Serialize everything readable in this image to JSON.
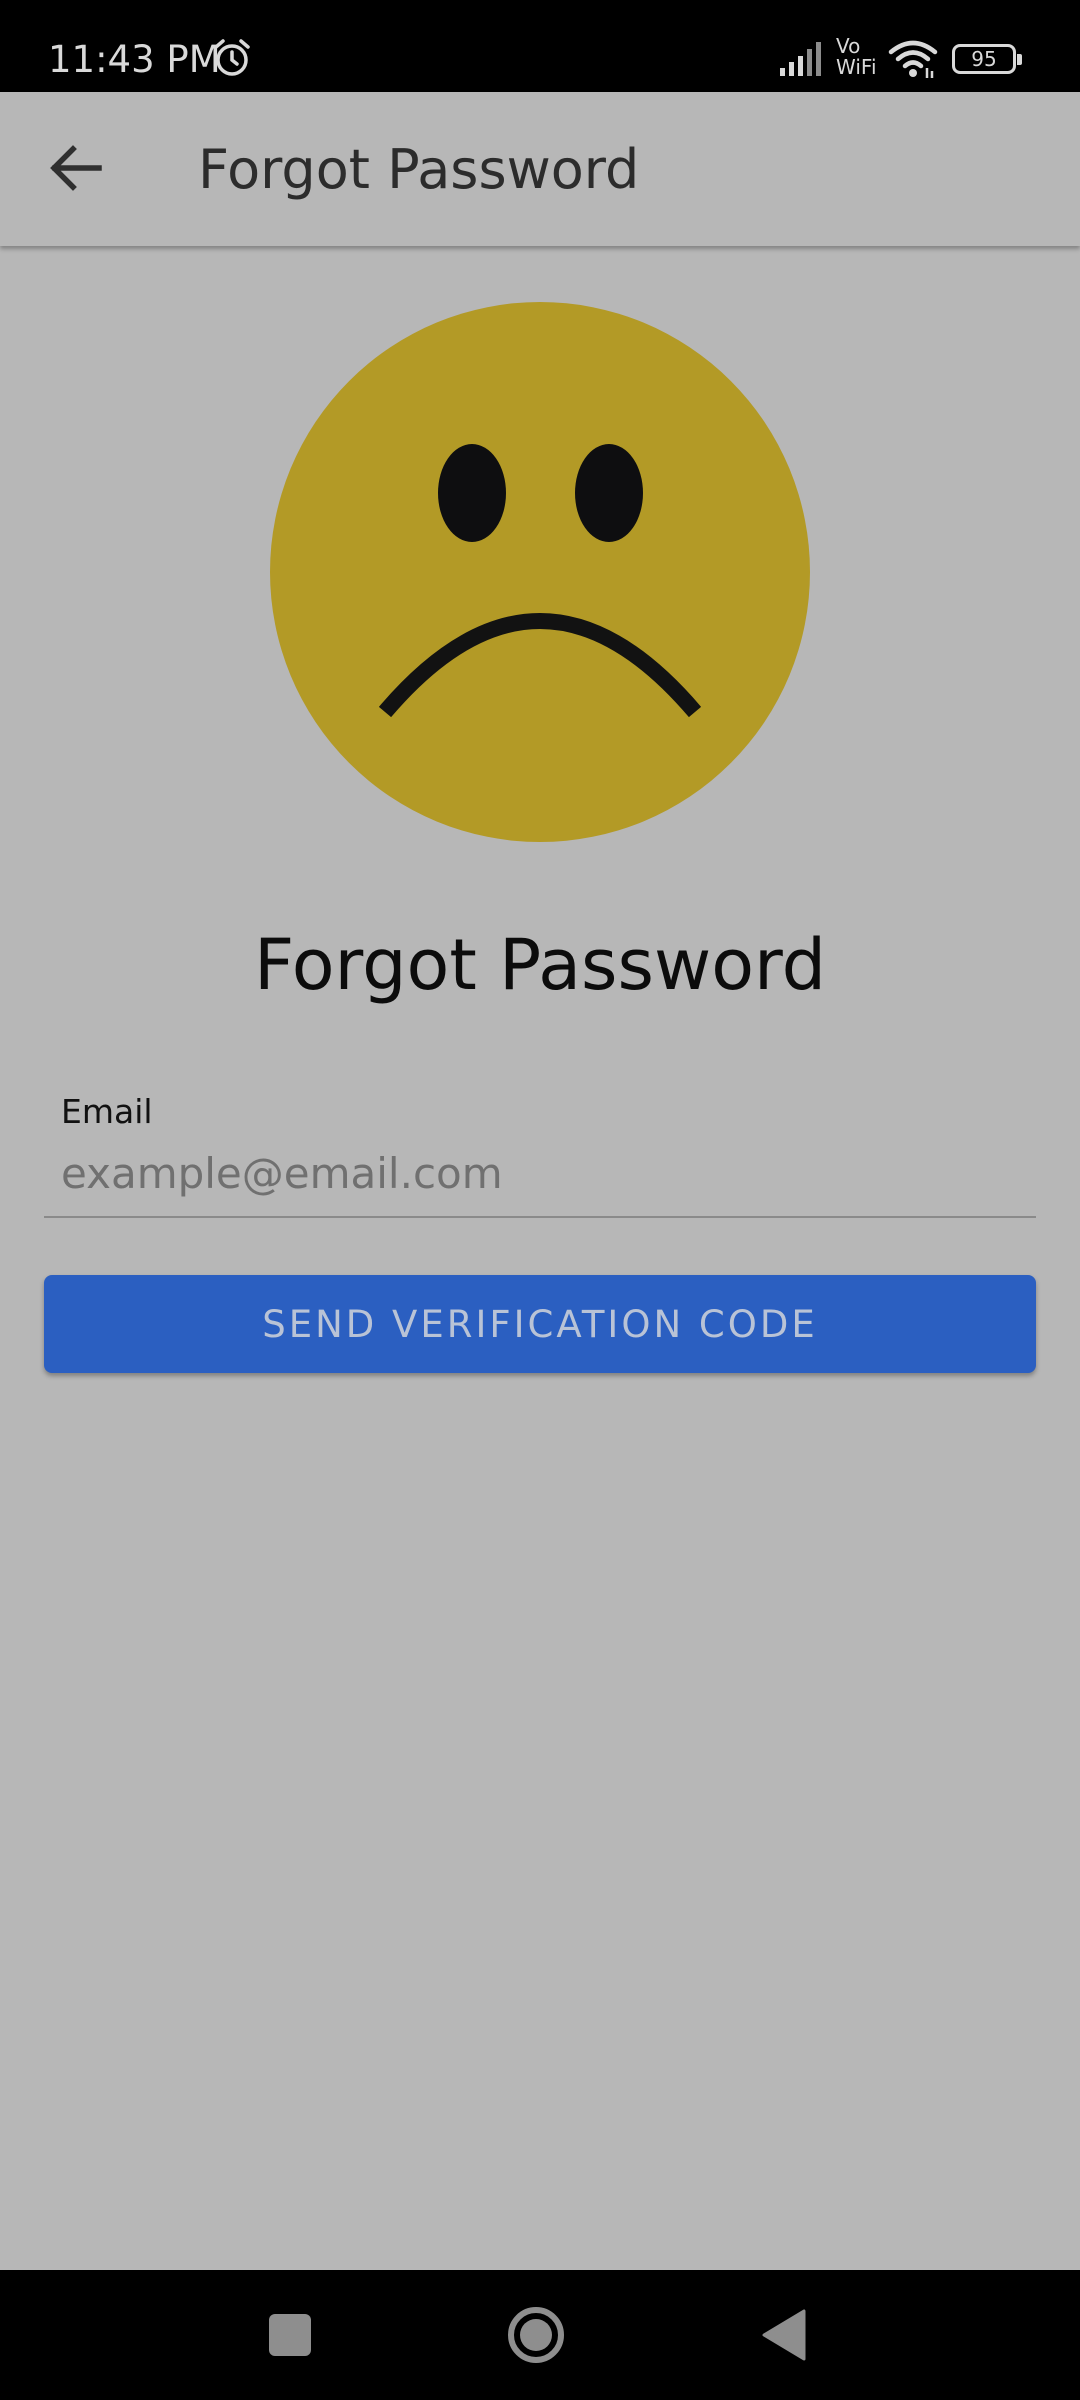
{
  "status_bar": {
    "time": "11:43 PM",
    "vowifi_top": "Vo",
    "vowifi_bottom": "WiFi",
    "battery": "95",
    "icons": [
      "alarm-icon",
      "signal-icon",
      "vowifi-icon",
      "wifi-icon",
      "battery-icon"
    ]
  },
  "app_bar": {
    "title": "Forgot Password",
    "back_icon": "arrow-left-icon"
  },
  "main": {
    "illustration": "sad-face-icon",
    "illustration_color": "#b39a26",
    "heading": "Forgot Password",
    "email_label": "Email",
    "email_placeholder": "example@email.com",
    "email_value": "",
    "send_button_label": "SEND VERIFICATION CODE",
    "accent_color": "#2b5fc1"
  },
  "nav_bar": {
    "icons": [
      "recents-square-icon",
      "home-circle-icon",
      "back-triangle-icon"
    ]
  }
}
